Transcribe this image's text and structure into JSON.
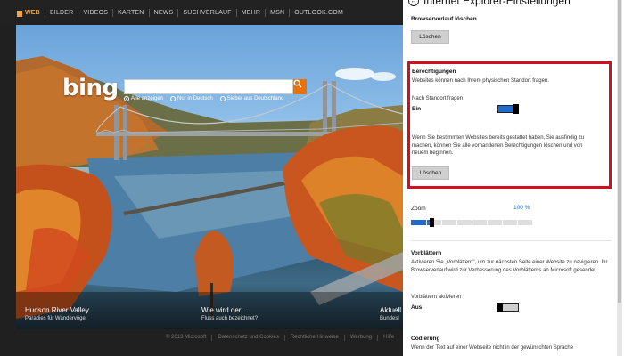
{
  "nav": {
    "items": [
      "WEB",
      "BILDER",
      "VIDEOS",
      "KARTEN",
      "NEWS",
      "SUCHVERLAUF",
      "MEHR",
      "MSN",
      "OUTLOOK.COM"
    ],
    "active_index": 0,
    "accent_color": "#f2a73b"
  },
  "bing": {
    "logo": "bing",
    "search_value": "",
    "radio_options": [
      {
        "label": "Alle anzeigen",
        "checked": true
      },
      {
        "label": "Nur in Deutsch",
        "checked": false
      },
      {
        "label": "Sieber aus Deutschland",
        "checked": false
      }
    ],
    "search_icon": "search-icon",
    "captions": [
      {
        "title": "Hudson River Valley",
        "subtitle": "Paradies für Wandervögel"
      },
      {
        "title": "Wie wird der...",
        "subtitle": "Fluss auch bezeichnet?"
      },
      {
        "title": "Aktuell",
        "subtitle": "Bundesl"
      }
    ],
    "footer": [
      "© 2013 Microsoft",
      "Datenschutz und Cookies",
      "Rechtliche Hinweise",
      "Werbung",
      "Hilfe"
    ]
  },
  "panel": {
    "title": "Internet Explorer-Einstellungen",
    "back_icon": "back-arrow-icon",
    "history": {
      "label": "Browserverlauf löschen",
      "button": "Löschen"
    },
    "permissions": {
      "heading": "Berechtigungen",
      "desc": "Websites können nach Ihrem physischen Standort fragen.",
      "location_label": "Nach Standort fragen",
      "location_state": "Ein",
      "location_on": true,
      "info": "Wenn Sie bestimmten Websites bereits gestattet haben, Sie ausfindig zu machen, können Sie alle vorhandenen Berechtigungen löschen und von neuem beginnen.",
      "button": "Löschen",
      "highlight_color": "#d0101e"
    },
    "zoom": {
      "label": "Zoom",
      "value": "100 %",
      "level": 0.17
    },
    "flip_ahead": {
      "heading": "Vorblättern",
      "desc": "Aktivieren Sie „Vorblättern\", um zur nächsten Seite einer Website zu navigieren. Ihr Browserverlauf wird zur Verbesserung des Vorblätterns an Microsoft gesendet.",
      "toggle_label": "Vorblättern aktivieren",
      "toggle_state": "Aus",
      "toggle_on": false
    },
    "encoding": {
      "heading": "Codierung",
      "desc": "Wenn der Text auf einer Webseite nicht in der gewünschten Sprache"
    },
    "accent_color": "#1e6ad2"
  }
}
